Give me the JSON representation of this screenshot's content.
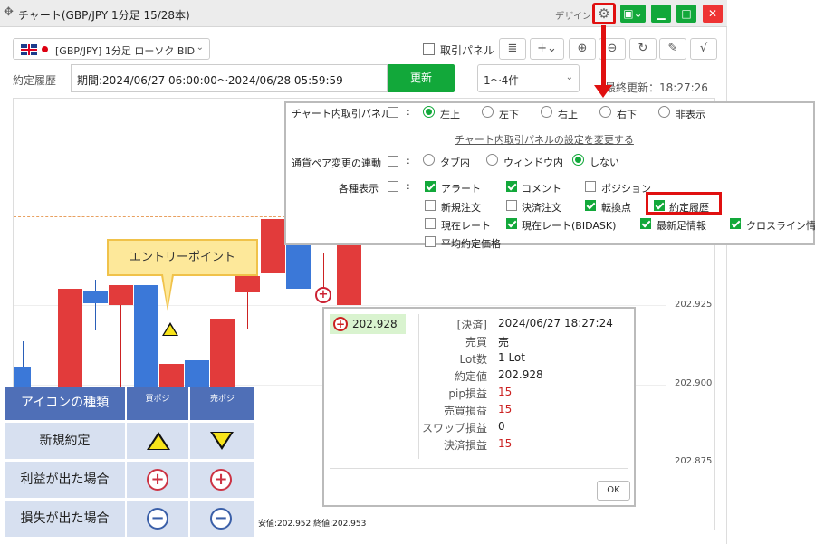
{
  "window": {
    "title": "チャート(GBP/JPY 1分足 15/28本)",
    "design_label": "デザイン",
    "move_icon": "move-icon",
    "settings_icon": "gear-icon"
  },
  "toolbar": {
    "symbol": "[GBP/JPY] 1分足 ローソク BID",
    "trade_panel_label": "取引パネル"
  },
  "history": {
    "label": "約定履歴",
    "period": "期間:2024/06/27 06:00:00～2024/06/28 05:59:59",
    "update_button": "更新",
    "count": "1～4件",
    "last_update": "最終更新：18:27:26"
  },
  "chart": {
    "price_labels": [
      "202.925",
      "202.900",
      "202.875"
    ],
    "ohlc_text": "安値:202.952 終値:202.953",
    "callout": "エントリーポイント"
  },
  "settings": {
    "panel_label": "チャート内取引パネル",
    "panel_positions": [
      "左上",
      "左下",
      "右上",
      "右下",
      "非表示"
    ],
    "panel_link": "チャート内取引パネルの設定を変更する",
    "pair_link_label": "通貨ペア変更の連動",
    "pair_link_options": [
      "タブ内",
      "ウィンドウ内",
      "しない"
    ],
    "display_label": "各種表示",
    "display_items": [
      {
        "label": "アラート",
        "checked": true
      },
      {
        "label": "コメント",
        "checked": true
      },
      {
        "label": "ポジション",
        "checked": false
      },
      {
        "label": "新規注文",
        "checked": false
      },
      {
        "label": "決済注文",
        "checked": false
      },
      {
        "label": "転換点",
        "checked": true
      },
      {
        "label": "約定履歴",
        "checked": true
      },
      {
        "label": "現在レート",
        "checked": false
      },
      {
        "label": "現在レート(BIDASK)",
        "checked": true
      },
      {
        "label": "最新足情報",
        "checked": true
      },
      {
        "label": "クロスライン情報",
        "checked": true
      },
      {
        "label": "平均約定価格",
        "checked": false
      }
    ],
    "colon": ":"
  },
  "detail": {
    "badge_price": "202.928",
    "rows": [
      {
        "label": "[決済]",
        "value": "2024/06/27 18:27:24",
        "red": false
      },
      {
        "label": "売買",
        "value": "売",
        "red": false
      },
      {
        "label": "Lot数",
        "value": "1 Lot",
        "red": false
      },
      {
        "label": "約定値",
        "value": "202.928",
        "red": false
      },
      {
        "label": "pip損益",
        "value": "15",
        "red": true
      },
      {
        "label": "売買損益",
        "value": "15",
        "red": true
      },
      {
        "label": "スワップ損益",
        "value": "0",
        "red": false
      },
      {
        "label": "決済損益",
        "value": "15",
        "red": true
      }
    ],
    "ok": "OK"
  },
  "legend": {
    "header": "アイコンの種類",
    "col_buy": "買ポジ",
    "col_sell": "売ポジ",
    "rows": [
      "新規約定",
      "利益が出た場合",
      "損失が出た場合"
    ]
  }
}
